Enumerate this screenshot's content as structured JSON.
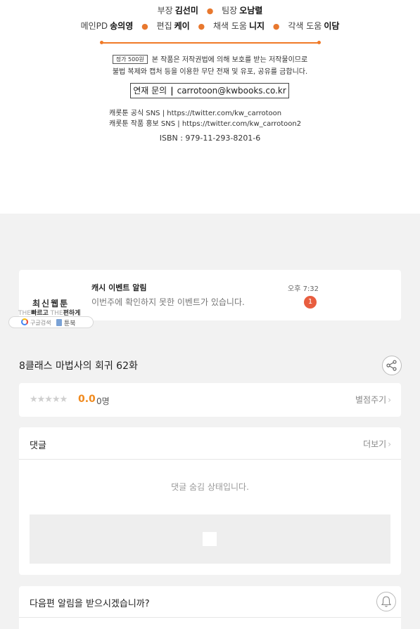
{
  "credits": {
    "staff_line1": [
      {
        "role": "부장",
        "name": "김선미"
      },
      {
        "role": "팀장",
        "name": "오남렬"
      }
    ],
    "staff_line2": [
      {
        "role": "메인PD",
        "name": "송의영"
      },
      {
        "role": "편집",
        "name": "케이"
      },
      {
        "role": "채색 도움",
        "name": "니지"
      },
      {
        "role": "각색 도움",
        "name": "이담"
      }
    ],
    "price_tag": "정가 500원",
    "notice_line1": "본 작품은 저작권법에 의해 보호를 받는 저작물이므로",
    "notice_line2": "불법 복제와 캡처 등을 이용한 무단 전재 및 유포, 공유를 금합니다.",
    "contact_label": "연재 문의",
    "contact_separator": "|",
    "contact_email": "carrotoon@kwbooks.co.kr",
    "sns_official": "캐롯툰 공식 SNS | https://twitter.com/kw_carrotoon",
    "sns_promo": "캐롯툰 작품 홍보 SNS | https://twitter.com/kw_carrotoon2",
    "isbn": "ISBN : 979-11-293-8201-6"
  },
  "notification": {
    "title": "캐시 이벤트 알림",
    "message": "이번주에 확인하지 못한 이벤트가 있습니다.",
    "time": "오후 7:32",
    "badge_count": "1"
  },
  "ad": {
    "title": "최신웹툰",
    "slogan_the1": "THE",
    "slogan_word1": "빠르고",
    "slogan_the2": "THE",
    "slogan_word2": "편하게",
    "google_label": "구글검색",
    "book_label": "툰북"
  },
  "episode": {
    "title": "8클래스 마법사의 회귀 62화"
  },
  "rating": {
    "stars": "★★★★★",
    "score": "0.0",
    "count": "0명",
    "rate_link": "별점주기",
    "chevron": "›"
  },
  "comments": {
    "title": "댓글",
    "more_link": "더보기",
    "chevron": "›",
    "hidden_notice": "댓글 숨김 상태입니다."
  },
  "alert": {
    "question": "다음편 알림을 받으시겠습니까?"
  },
  "colors": {
    "accent_orange": "#f07a28",
    "score_orange": "#f08a1e",
    "badge_red": "#e85d3f"
  },
  "icons": [
    "share-icon",
    "bell-icon",
    "google-g-icon",
    "book-icon",
    "image-placeholder-icon"
  ]
}
